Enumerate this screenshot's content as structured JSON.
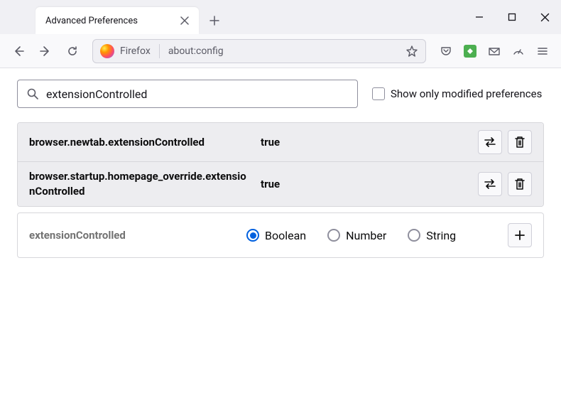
{
  "tab": {
    "title": "Advanced Preferences"
  },
  "address": {
    "browser_label": "Firefox",
    "url": "about:config"
  },
  "search": {
    "value": "extensionControlled"
  },
  "modified_only": {
    "label": "Show only modified preferences",
    "checked": false
  },
  "prefs": [
    {
      "name": "browser.newtab.extensionControlled",
      "value": "true"
    },
    {
      "name": "browser.startup.homepage_override.extensionControlled",
      "value": "true"
    }
  ],
  "new_pref": {
    "name": "extensionControlled",
    "types": {
      "boolean": "Boolean",
      "number": "Number",
      "string": "String"
    },
    "selected": "boolean"
  }
}
